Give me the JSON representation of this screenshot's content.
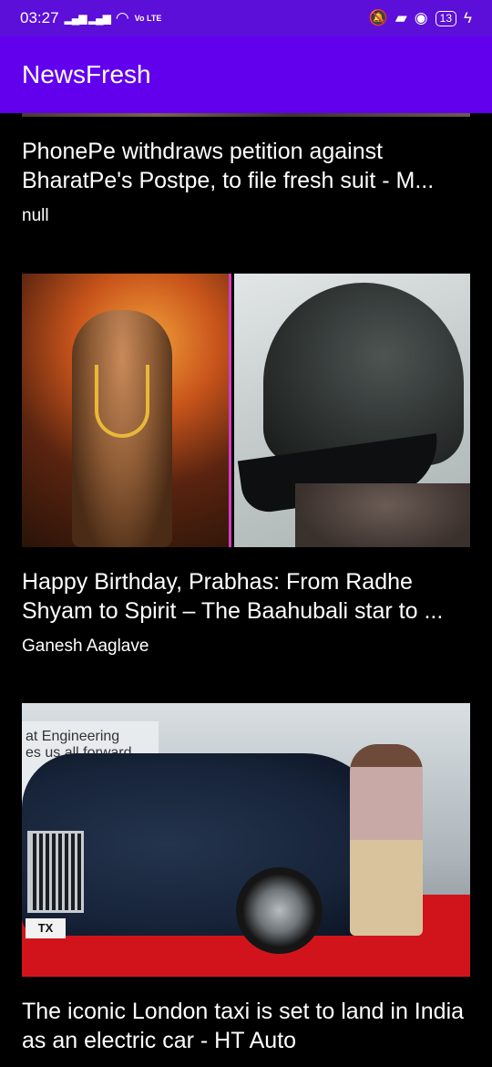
{
  "status_bar": {
    "time": "03:27",
    "volte": "Vo LTE",
    "battery": "13"
  },
  "app": {
    "title": "NewsFresh"
  },
  "articles": [
    {
      "title": "PhonePe withdraws petition against BharatPe's Postpe, to file fresh suit - M...",
      "author": "null"
    },
    {
      "title": "Happy Birthday, Prabhas: From Radhe Shyam to Spirit – The Baahubali star to ...",
      "author": "Ganesh Aaglave"
    },
    {
      "title": "The iconic London taxi is set to land in India as an electric car - HT Auto",
      "author": "",
      "image_text": {
        "banner_line1": "at Engineering",
        "banner_line2": "es us all forward",
        "plate": "TX"
      }
    }
  ],
  "colors": {
    "status_bar": "#5b0fd8",
    "app_bar": "#6200ee",
    "background": "#000000"
  }
}
